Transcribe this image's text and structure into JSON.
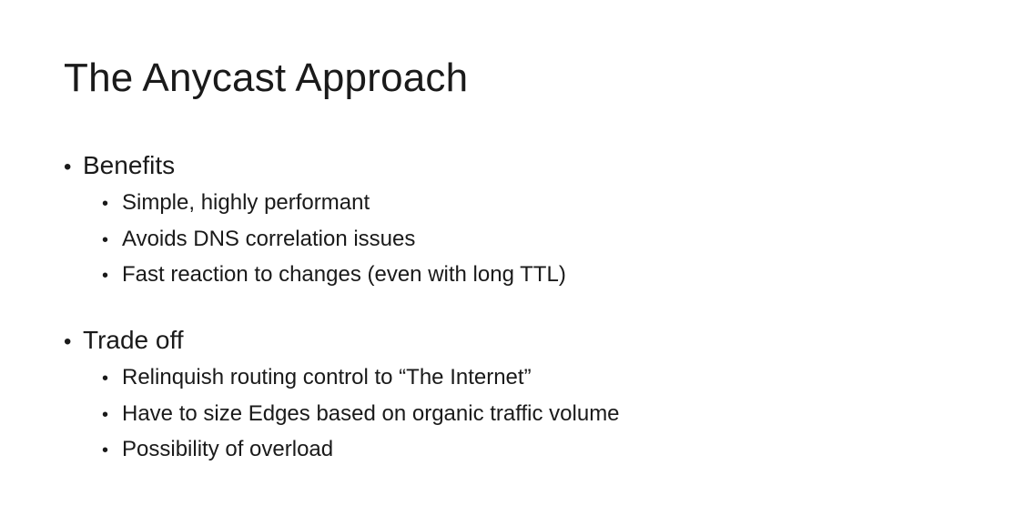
{
  "slide": {
    "title": "The Anycast Approach",
    "bullet_glyph": "•",
    "sections": [
      {
        "heading": "Benefits",
        "items": [
          "Simple, highly performant",
          "Avoids DNS correlation issues",
          "Fast reaction to changes (even with long TTL)"
        ]
      },
      {
        "heading": "Trade off",
        "items": [
          "Relinquish routing control to “The Internet”",
          "Have to size Edges based on organic traffic volume",
          "Possibility of overload"
        ]
      }
    ]
  }
}
